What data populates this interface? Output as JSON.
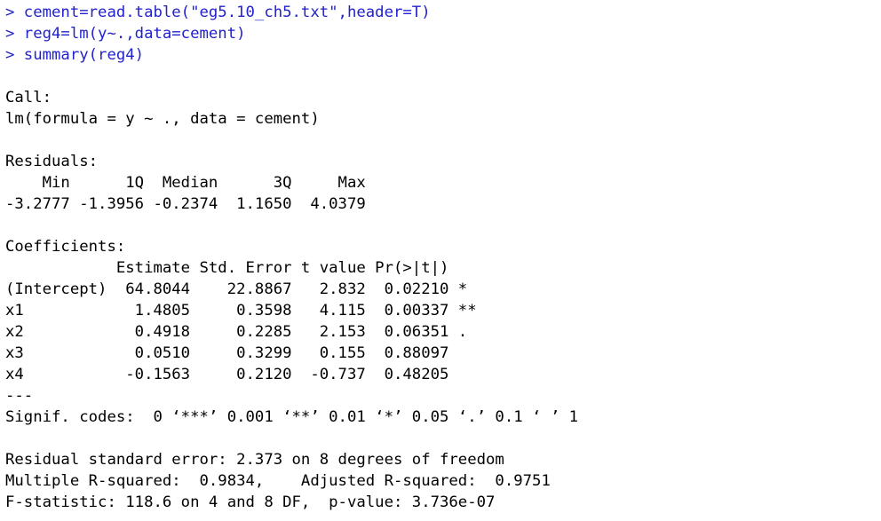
{
  "console": {
    "app": "R Console",
    "prompt_symbol": ">",
    "colors": {
      "background": "#ffffff",
      "output_text": "#000000",
      "command_text": "#2222cc"
    },
    "commands": [
      {
        "prompt": ">",
        "text": "cement=read.table(\"eg5.10_ch5.txt\",header=T)"
      },
      {
        "prompt": ">",
        "text": "reg4=lm(y~.,data=cement)"
      },
      {
        "prompt": ">",
        "text": "summary(reg4)"
      }
    ],
    "lines": [
      "> cement=read.table(\"eg5.10_ch5.txt\",header=T)",
      "> reg4=lm(y~.,data=cement)",
      "> summary(reg4)",
      "",
      "Call:",
      "lm(formula = y ~ ., data = cement)",
      "",
      "Residuals:",
      "    Min      1Q  Median      3Q     Max ",
      "-3.2777 -1.3956 -0.2374  1.1650  4.0379 ",
      "",
      "Coefficients:",
      "            Estimate Std. Error t value Pr(>|t|)   ",
      "(Intercept)  64.8044    22.8867   2.832  0.02210 * ",
      "x1            1.4805     0.3598   4.115  0.00337 **",
      "x2            0.4918     0.2285   2.153  0.06351 . ",
      "x3            0.0510     0.3299   0.155  0.88097   ",
      "x4           -0.1563     0.2120  -0.737  0.48205   ",
      "---",
      "Signif. codes:  0 ‘***’ 0.001 ‘**’ 0.01 ‘*’ 0.05 ‘.’ 0.1 ‘ ’ 1",
      "",
      "Residual standard error: 2.373 on 8 degrees of freedom",
      "Multiple R-squared:  0.9834,    Adjusted R-squared:  0.9751 ",
      "F-statistic: 118.6 on 4 and 8 DF,  p-value: 3.736e-07"
    ],
    "output": {
      "call": {
        "label": "Call:",
        "formula": "lm(formula = y ~ ., data = cement)"
      },
      "residuals": {
        "label": "Residuals:",
        "headers": [
          "Min",
          "1Q",
          "Median",
          "3Q",
          "Max"
        ],
        "values": [
          "-3.2777",
          "-1.3956",
          "-0.2374",
          "1.1650",
          "4.0379"
        ]
      },
      "coefficients": {
        "label": "Coefficients:",
        "headers": [
          "",
          "Estimate",
          "Std. Error",
          "t value",
          "Pr(>|t|)",
          ""
        ],
        "rows": [
          {
            "term": "(Intercept)",
            "estimate": "64.8044",
            "std_error": "22.8867",
            "t_value": "2.832",
            "p_value": "0.02210",
            "signif": "*"
          },
          {
            "term": "x1",
            "estimate": "1.4805",
            "std_error": "0.3598",
            "t_value": "4.115",
            "p_value": "0.00337",
            "signif": "**"
          },
          {
            "term": "x2",
            "estimate": "0.4918",
            "std_error": "0.2285",
            "t_value": "2.153",
            "p_value": "0.06351",
            "signif": "."
          },
          {
            "term": "x3",
            "estimate": "0.0510",
            "std_error": "0.3299",
            "t_value": "0.155",
            "p_value": "0.88097",
            "signif": ""
          },
          {
            "term": "x4",
            "estimate": "-0.1563",
            "std_error": "0.2120",
            "t_value": "-0.737",
            "p_value": "0.48205",
            "signif": ""
          }
        ]
      },
      "separator": "---",
      "signif_codes": "Signif. codes:  0 ‘***’ 0.001 ‘**’ 0.01 ‘*’ 0.05 ‘.’ 0.1 ‘ ’ 1",
      "stats": {
        "residual_standard_error_line": "Residual standard error: 2.373 on 8 degrees of freedom",
        "residual_standard_error": "2.373",
        "residual_df": "8",
        "r_squared_line": "Multiple R-squared:  0.9834,    Adjusted R-squared:  0.9751 ",
        "multiple_r_squared": "0.9834",
        "adjusted_r_squared": "0.9751",
        "f_statistic_line": "F-statistic: 118.6 on 4 and 8 DF,  p-value: 3.736e-07",
        "f_statistic": "118.6",
        "f_df_numerator": "4",
        "f_df_denominator": "8",
        "p_value": "3.736e-07"
      }
    }
  }
}
